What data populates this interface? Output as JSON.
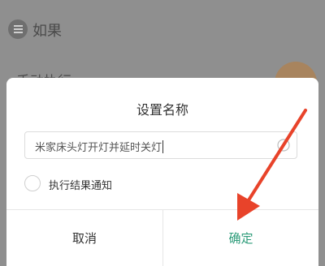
{
  "background": {
    "title": "如果",
    "subtitle": "手动执行"
  },
  "dialog": {
    "title": "设置名称",
    "name_value": "米家床头灯开灯并延时关灯",
    "notify_label": "执行结果通知",
    "cancel_label": "取消",
    "confirm_label": "确定"
  },
  "colors": {
    "confirm": "#2e9c7a",
    "annotation_arrow": "#e8432a"
  }
}
